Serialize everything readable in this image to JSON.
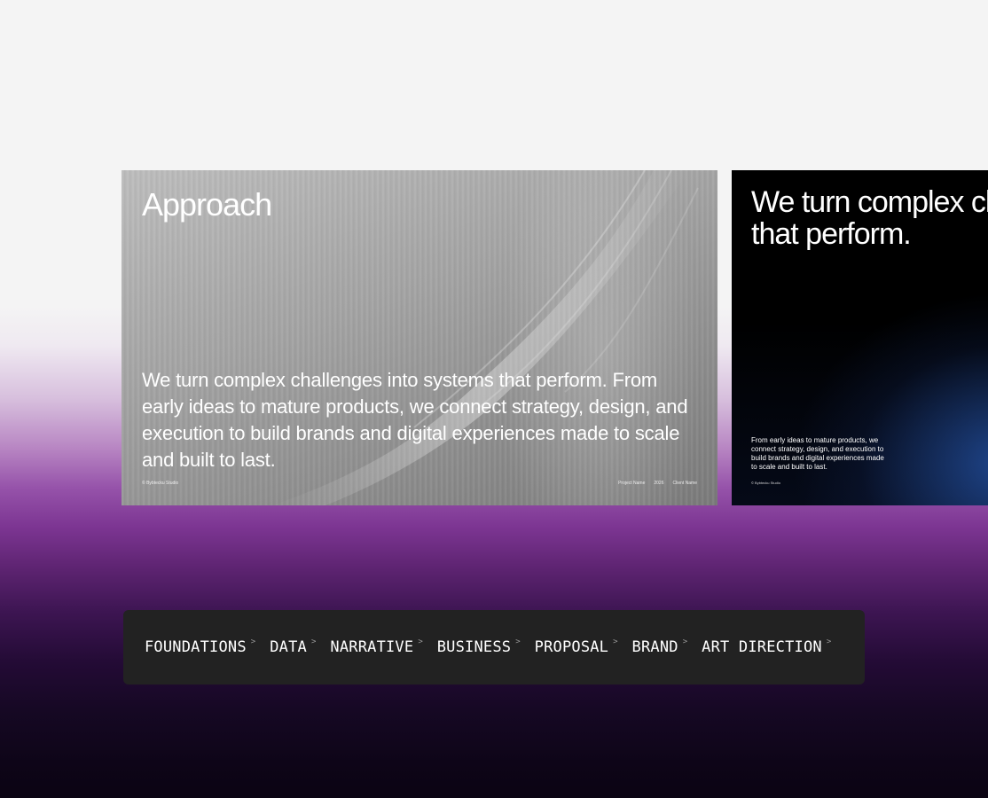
{
  "slides": {
    "approach": {
      "title": "Approach",
      "body": "We turn complex challenges into systems that perform. From early ideas to mature products, we connect strategy, design, and execution to build brands and digital experiences made to scale and built to last.",
      "footer_left": "© Bybtecku Studio",
      "footer_right": [
        "Project Name",
        "2026",
        "Client Name"
      ]
    },
    "dark": {
      "title": "We turn complex challenges into systems that perform.",
      "body": "From early ideas to mature products, we connect strategy, design, and execution to build brands and digital experiences made to scale and built to last.",
      "footer": "© Bybtecku Studio"
    }
  },
  "nav": {
    "chevron": ">",
    "items": [
      {
        "label": "FOUNDATIONS"
      },
      {
        "label": "DATA"
      },
      {
        "label": "NARRATIVE"
      },
      {
        "label": "BUSINESS"
      },
      {
        "label": "PROPOSAL"
      },
      {
        "label": "BRAND"
      },
      {
        "label": "ART DIRECTION"
      }
    ]
  },
  "colors": {
    "nav_background": "#222222",
    "page_background": "#f4f4f4",
    "accent_purple": "#7c3592"
  }
}
